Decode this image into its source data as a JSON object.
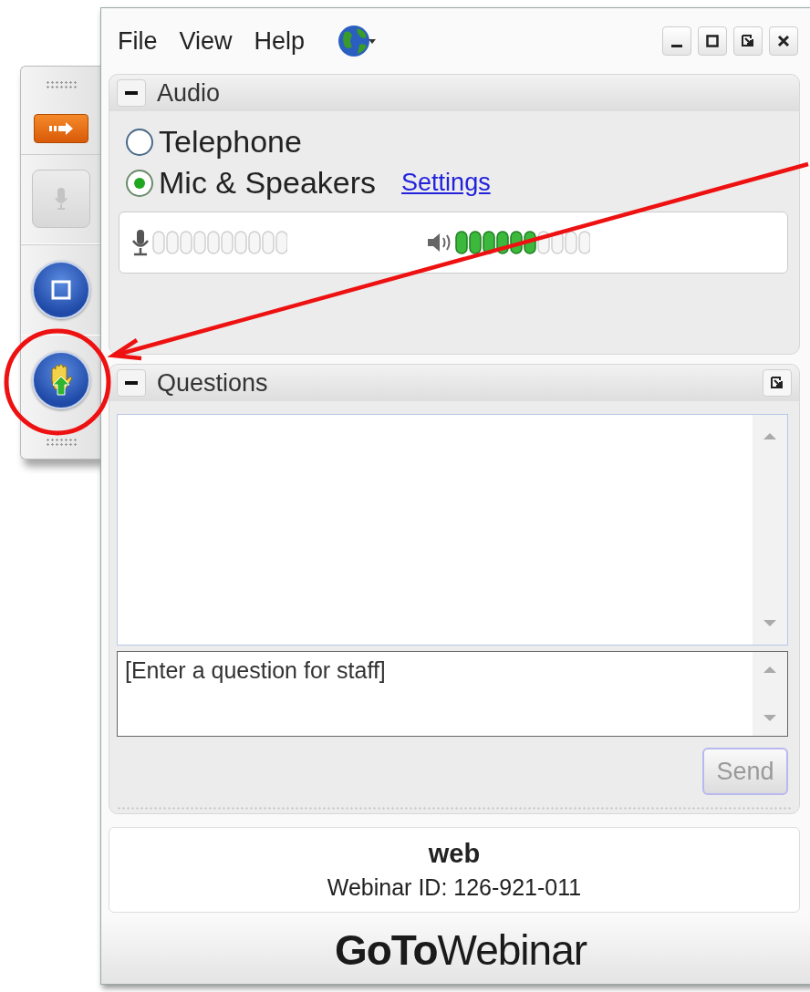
{
  "menu": [
    {
      "label": "File"
    },
    {
      "label": "View"
    },
    {
      "label": "Help"
    }
  ],
  "toolbar": [
    {
      "kind": "arrow",
      "disabled": false
    },
    {
      "kind": "mic",
      "disabled": true
    },
    {
      "kind": "screen",
      "disabled": false
    },
    {
      "kind": "hand",
      "disabled": false
    }
  ],
  "audio_panel": {
    "title": "Audio",
    "options": [
      {
        "label": "Telephone",
        "selected": false
      },
      {
        "label": "Mic & Speakers",
        "selected": true
      }
    ],
    "settings_link": "Settings"
  },
  "questions_panel": {
    "title": "Questions",
    "input": {
      "placeholder": "[Enter a question for staff]"
    },
    "send_button": {
      "label": "Send",
      "disabled": true
    }
  },
  "session": {
    "name": "web",
    "webinar_id": "Webinar ID: 126-921-011"
  },
  "logo": "**GoTo**Webinar"
}
